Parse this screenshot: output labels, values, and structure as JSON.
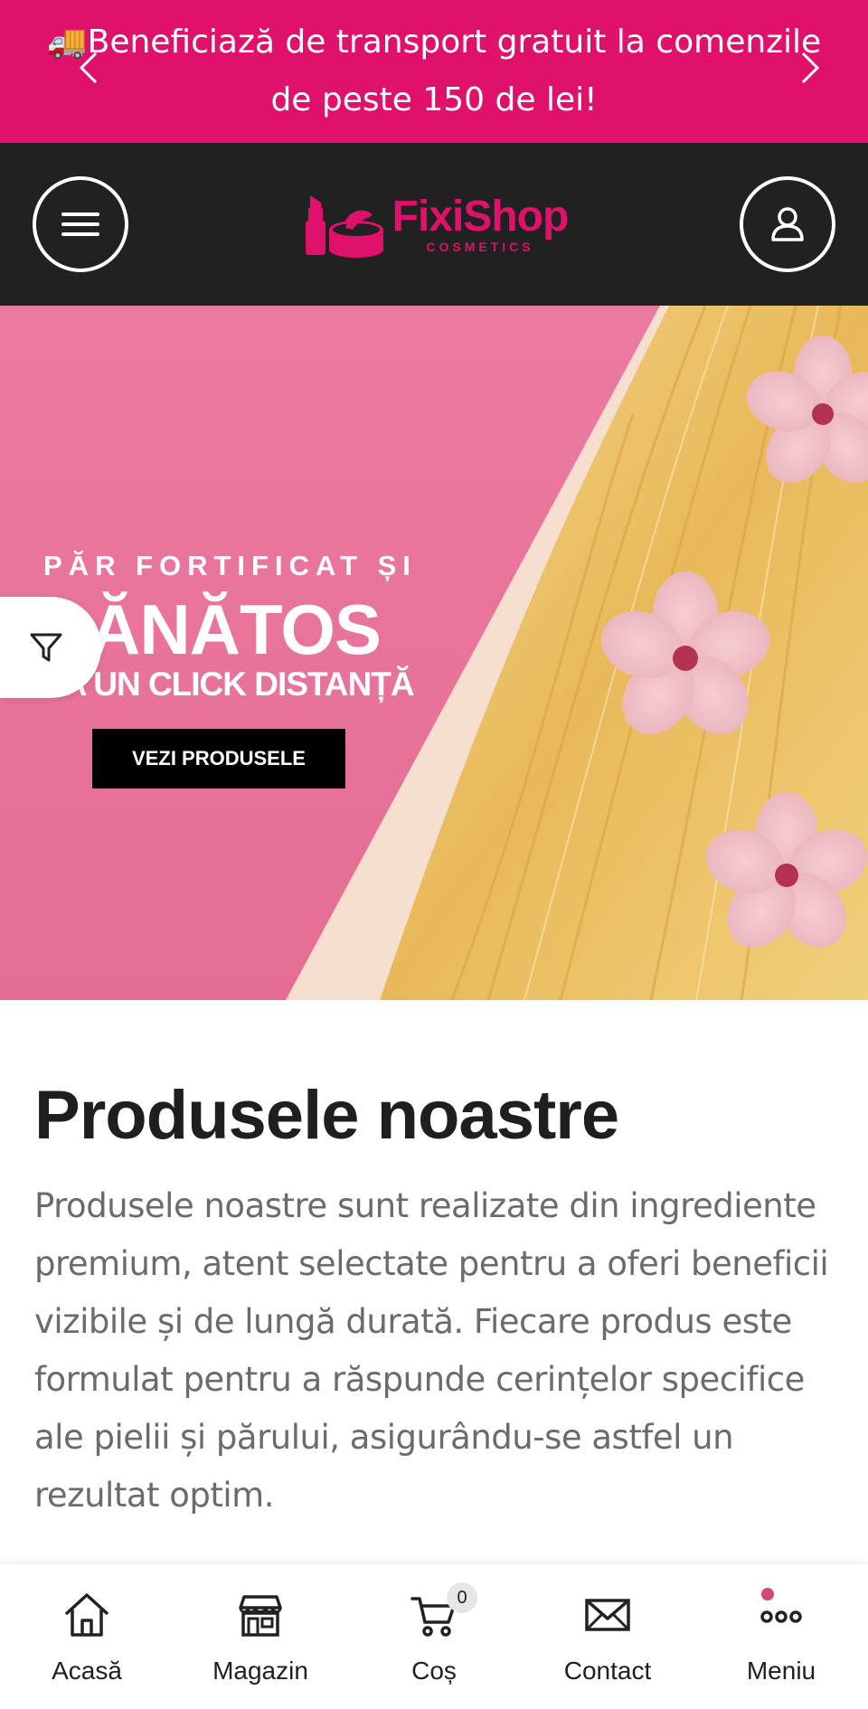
{
  "announcement": {
    "icon": "truck-icon",
    "text": "🚚Beneficiază de transport gratuit la comenzile de peste 150 de lei!"
  },
  "header": {
    "logo_name": "FixiShop",
    "logo_sub": "COSMETICS",
    "menu_icon": "hamburger-icon",
    "account_icon": "user-icon"
  },
  "hero": {
    "eyebrow": "PĂR FORTIFICAT ȘI",
    "title": "SĂNĂTOS",
    "subtitle": "LA UN CLICK DISTANȚĂ",
    "cta": "VEZI PRODUSELE"
  },
  "products": {
    "title": "Produsele noastre",
    "description": "Produsele noastre sunt realizate din ingrediente premium, atent selectate pentru a oferi beneficii vizibile și de lungă durată. Fiecare produs este formulat pentru a răspunde cerințelor specifice ale pielii și părului, asigurându-se astfel un rezultat optim."
  },
  "bottom_nav": {
    "home": "Acasă",
    "shop": "Magazin",
    "cart": "Coș",
    "cart_count": "0",
    "contact": "Contact",
    "menu": "Meniu"
  },
  "colors": {
    "brand": "#e0116a",
    "header_bg": "#212121",
    "hero_pink": "#e56d94"
  }
}
